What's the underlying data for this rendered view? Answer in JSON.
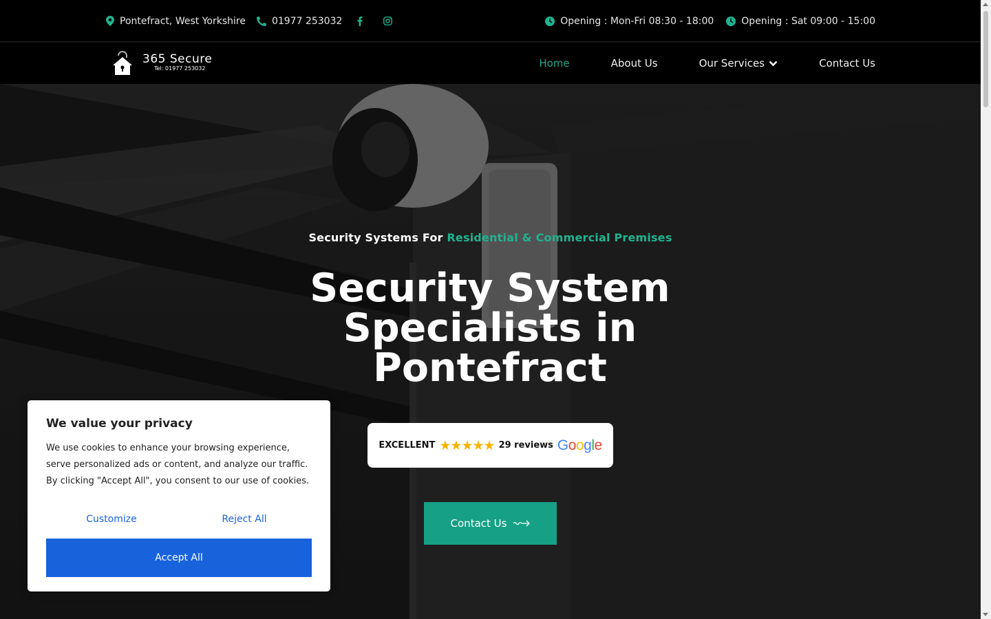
{
  "topbar": {
    "location": "Pontefract, West Yorkshire",
    "phone": "01977 253032",
    "hours_weekday": "Opening : Mon-Fri 08:30 - 18:00",
    "hours_saturday": "Opening : Sat 09:00 - 15:00",
    "icons": [
      "map-pin-icon",
      "phone-icon",
      "facebook-icon",
      "instagram-icon",
      "clock-icon"
    ],
    "accent_color": "#20b38f"
  },
  "brand": {
    "name": "365 Secure",
    "tel": "Tel: 01977 253032"
  },
  "nav": {
    "items": [
      {
        "label": "Home",
        "active": true
      },
      {
        "label": "About Us"
      },
      {
        "label": "Our Services",
        "dropdown": true
      },
      {
        "label": "Contact Us"
      }
    ]
  },
  "hero": {
    "tagline_prefix": "Security Systems For",
    "tagline_accent": "Residential & Commercial Premises",
    "title_line1": "Security System",
    "title_line2": "Specialists in",
    "title_line3": "Pontefract",
    "reviews": {
      "rating_label": "EXCELLENT",
      "stars": 5,
      "count": "29 reviews",
      "provider": "Google"
    },
    "cta_label": "Contact Us"
  },
  "cookie": {
    "title": "We value your privacy",
    "body": "We use cookies to enhance your browsing experience, serve personalized ads or content, and analyze our traffic. By clicking \"Accept All\", you consent to our use of cookies.",
    "customize": "Customize",
    "reject": "Reject All",
    "accept": "Accept All",
    "accent_color": "#1863dc"
  }
}
